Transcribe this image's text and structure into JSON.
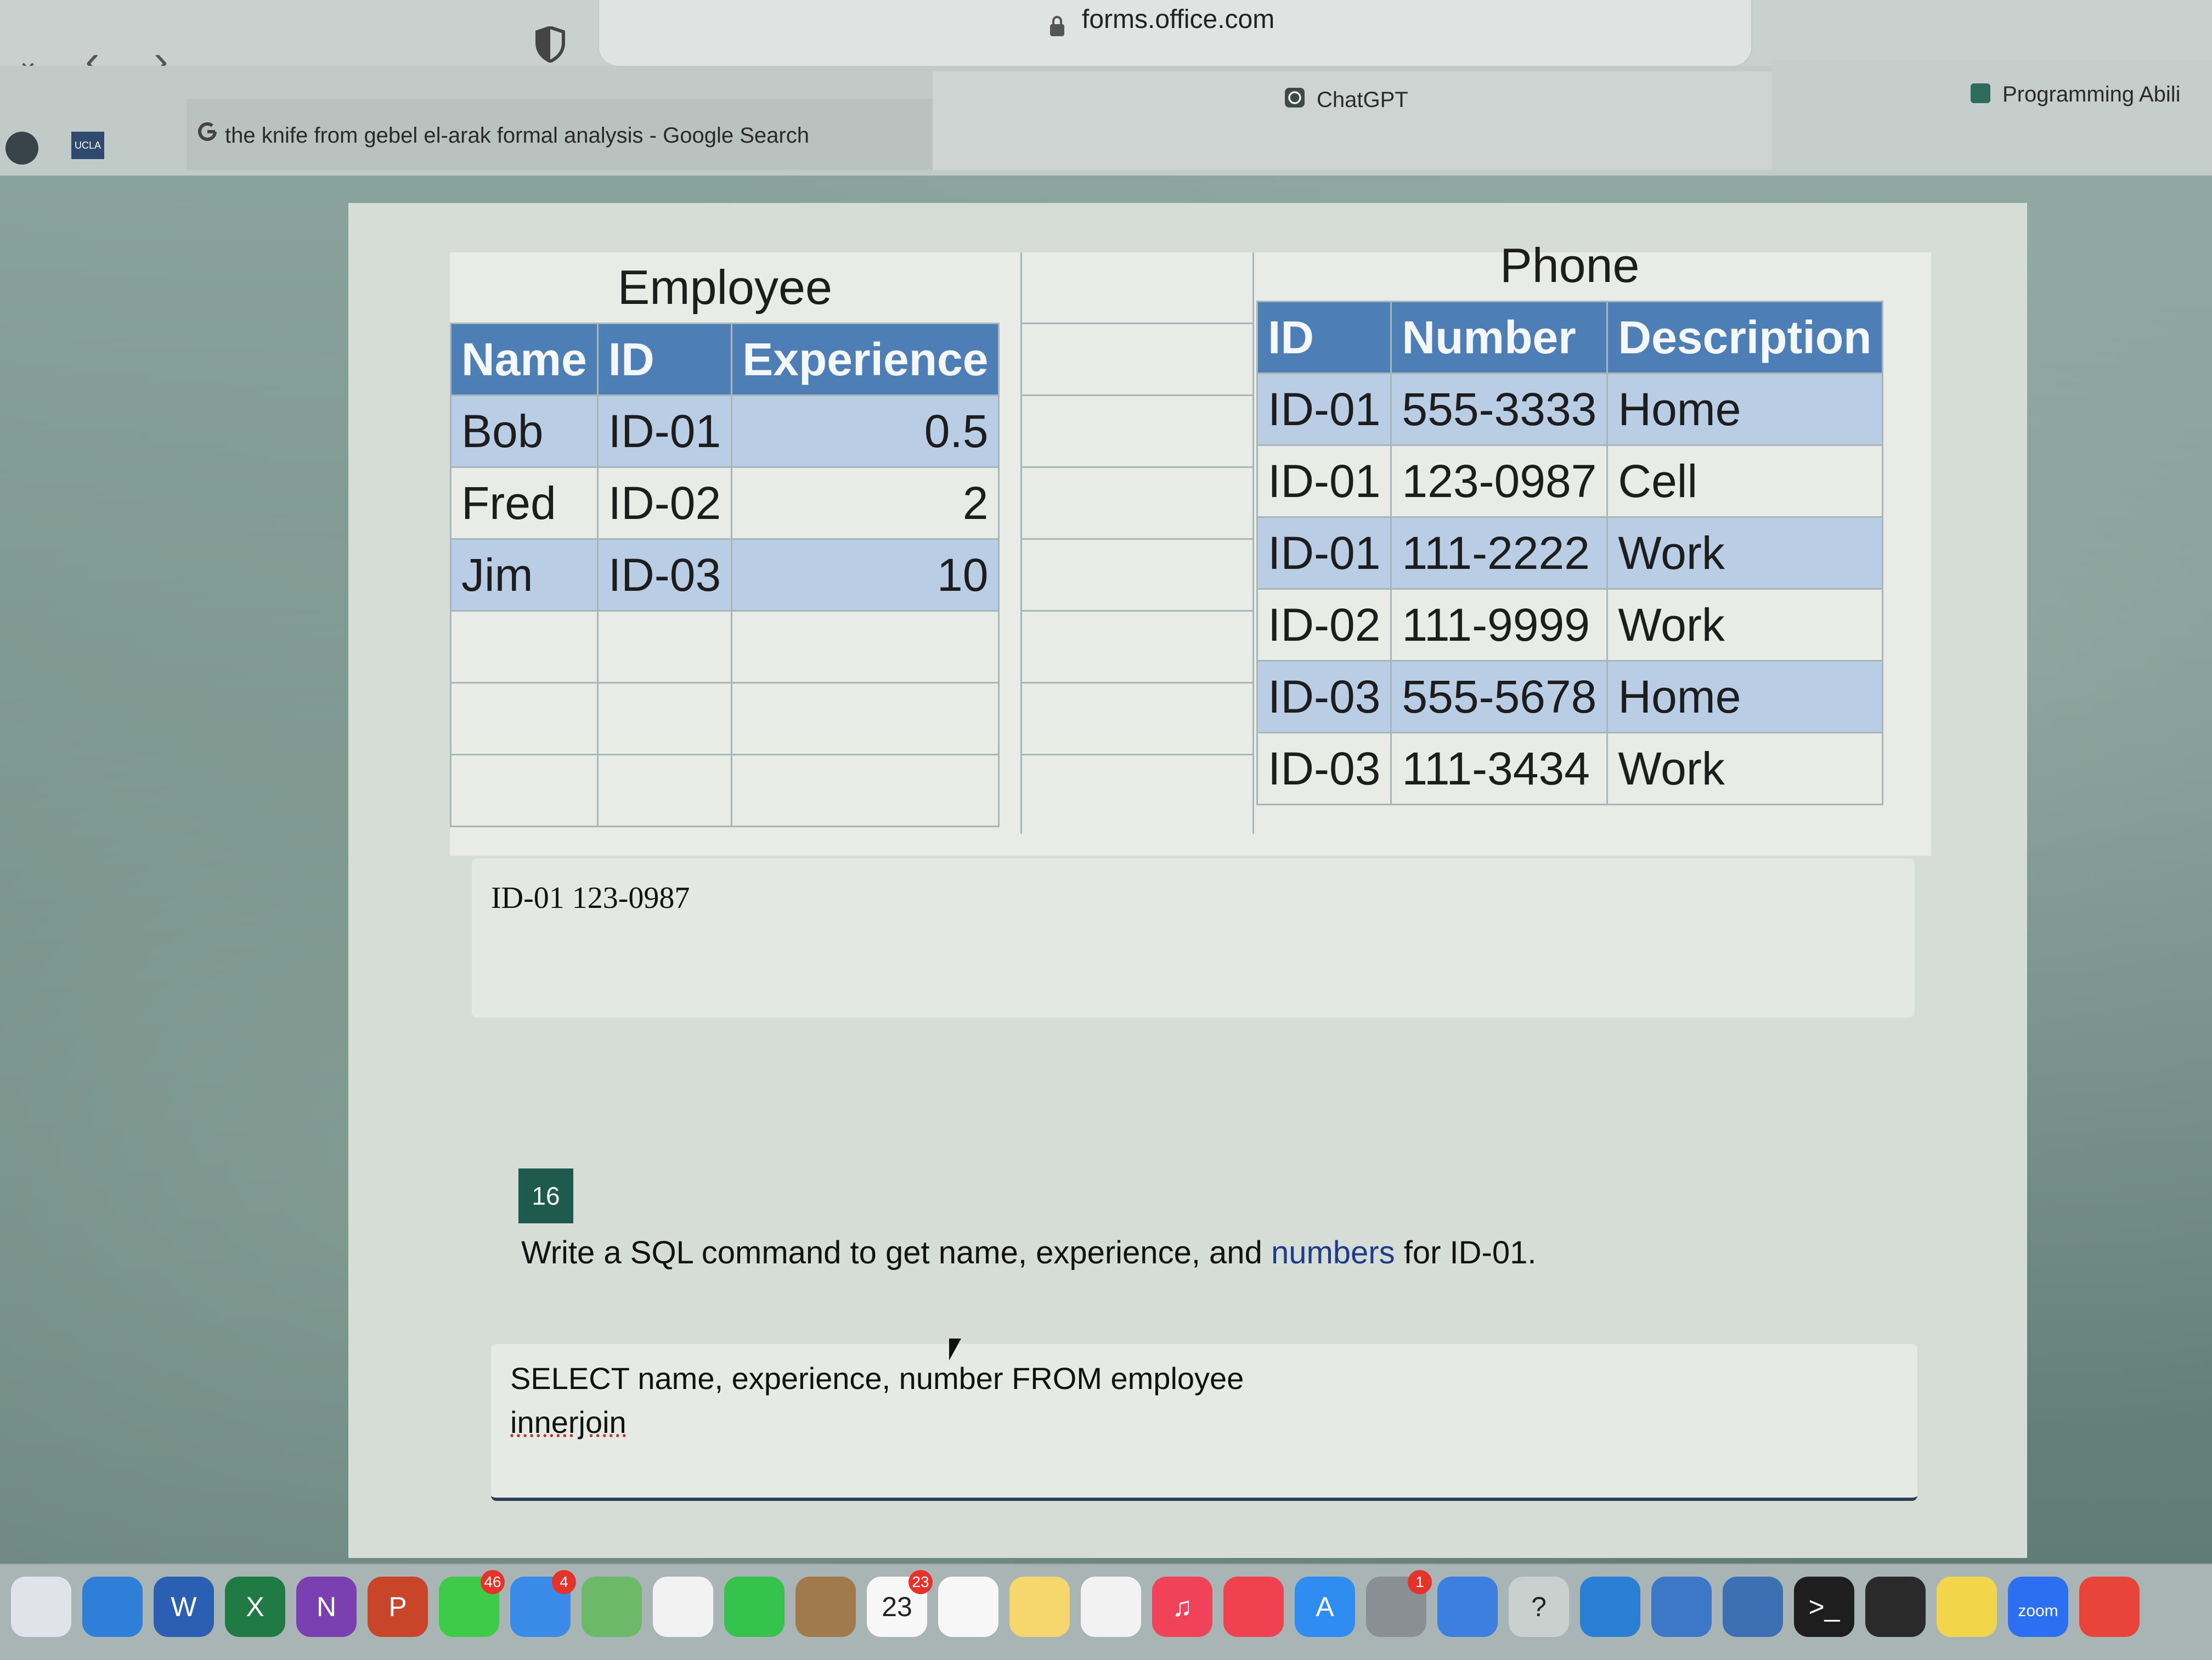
{
  "browser": {
    "url": "forms.office.com",
    "tabs": [
      {
        "label": "the knife from gebel el-arak formal analysis - Google Search"
      },
      {
        "label": "ChatGPT"
      },
      {
        "label": "Programming Abili"
      }
    ],
    "bookmarks": [
      "UCLA"
    ]
  },
  "image_table": {
    "employee_title": "Employee",
    "employee_headers": [
      "Name",
      "ID",
      "Experience"
    ],
    "employee_rows": [
      [
        "Bob",
        "ID-01",
        "0.5"
      ],
      [
        "Fred",
        "ID-02",
        "2"
      ],
      [
        "Jim",
        "ID-03",
        "10"
      ]
    ],
    "phone_title": "Phone",
    "phone_headers": [
      "ID",
      "Number",
      "Description"
    ],
    "phone_rows": [
      [
        "ID-01",
        "555-3333",
        "Home"
      ],
      [
        "ID-01",
        "123-0987",
        "Cell"
      ],
      [
        "ID-01",
        "111-2222",
        "Work"
      ],
      [
        "ID-02",
        "111-9999",
        "Work"
      ],
      [
        "ID-03",
        "555-5678",
        "Home"
      ],
      [
        "ID-03",
        "111-3434",
        "Work"
      ]
    ]
  },
  "previous_answer": "ID-01 123-0987",
  "question": {
    "number": "16",
    "text_before": "Write a SQL command to get name, experience, and ",
    "text_highlight": "numbers",
    "text_after": " for ID-01."
  },
  "answer_input": {
    "line1": "SELECT name, experience, number FROM employee",
    "line2": "innerjoin"
  },
  "dock": {
    "items": [
      {
        "icon": "launchpad-icon",
        "color": "#e0e4ea"
      },
      {
        "icon": "safari-icon",
        "color": "#2f7fd8"
      },
      {
        "icon": "word-icon",
        "color": "#2b5fb3",
        "glyph": "W"
      },
      {
        "icon": "excel-icon",
        "color": "#1f7a44",
        "glyph": "X"
      },
      {
        "icon": "onenote-icon",
        "color": "#7a3fb0",
        "glyph": "N"
      },
      {
        "icon": "powerpoint-icon",
        "color": "#c8452a",
        "glyph": "P"
      },
      {
        "icon": "messages-icon",
        "color": "#3fcb4a",
        "badge": "46"
      },
      {
        "icon": "mail-icon",
        "color": "#3a8be8",
        "badge": "4"
      },
      {
        "icon": "maps-icon",
        "color": "#6cb96a"
      },
      {
        "icon": "photos-icon",
        "color": "#f2f2f2"
      },
      {
        "icon": "facetime-icon",
        "color": "#35c24d"
      },
      {
        "icon": "archive-icon",
        "color": "#a07a4a"
      },
      {
        "icon": "calendar-icon",
        "color": "#f7f7f7",
        "glyph": "23",
        "badge": "23"
      },
      {
        "icon": "reminders-icon",
        "color": "#f7f7f7"
      },
      {
        "icon": "notes-icon",
        "color": "#f5d76e"
      },
      {
        "icon": "freeform-icon",
        "color": "#f2f2f2"
      },
      {
        "icon": "music-icon",
        "color": "#f0435a",
        "glyph": "♫"
      },
      {
        "icon": "news-icon",
        "color": "#ef4150"
      },
      {
        "icon": "appstore-icon",
        "color": "#2f8cf0",
        "glyph": "A"
      },
      {
        "icon": "settings-icon",
        "color": "#8a8f94",
        "badge": "1"
      },
      {
        "icon": "screen-sharing-icon",
        "color": "#3d7fe0"
      },
      {
        "icon": "help-icon",
        "color": "#c9d0cd",
        "glyph": "?"
      },
      {
        "icon": "vscode-icon",
        "color": "#2a7fd4"
      },
      {
        "icon": "xcode-icon",
        "color": "#3d78c8"
      },
      {
        "icon": "developer-tool-icon",
        "color": "#3c6fb4"
      },
      {
        "icon": "terminal-icon",
        "color": "#1e1e1e",
        "glyph": ">_"
      },
      {
        "icon": "activity-monitor-icon",
        "color": "#2a2a2a"
      },
      {
        "icon": "stickies-icon",
        "color": "#f3d54c"
      },
      {
        "icon": "zoom-icon",
        "color": "#2d6ff2",
        "glyph": "zoom"
      },
      {
        "icon": "chrome-icon",
        "color": "#e9443a"
      }
    ]
  }
}
